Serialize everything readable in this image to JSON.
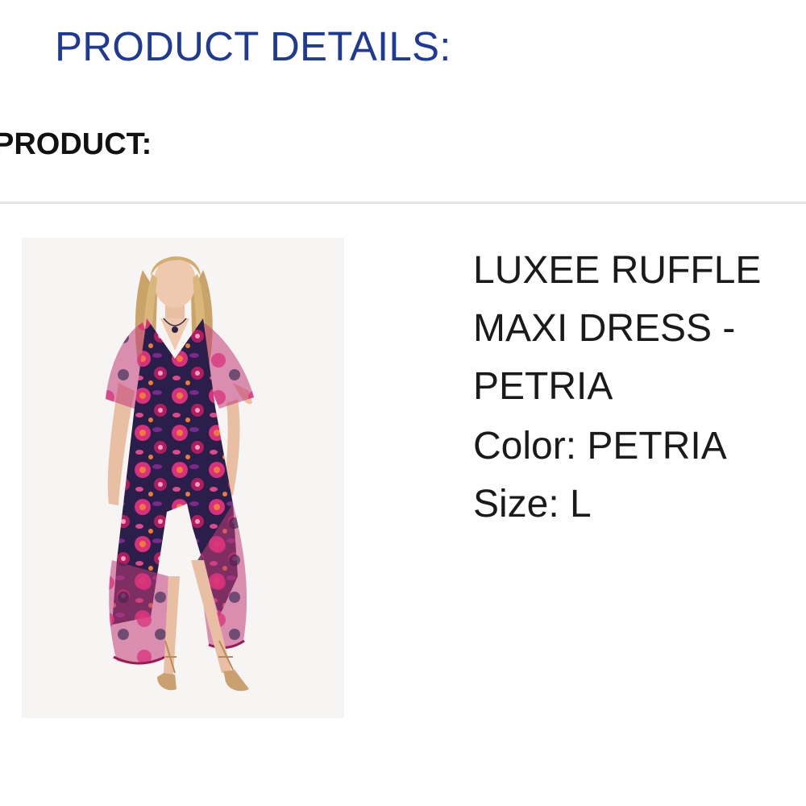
{
  "header": {
    "title": "PRODUCT DETAILS:",
    "section_label": "PRODUCT:"
  },
  "product": {
    "name": "LUXEE RUFFLE\nMAXI DRESS -\nPETRIA",
    "color_line": "Color: PETRIA",
    "size_line": "Size: L",
    "image_subject": "model-wearing-floral-ruffle-maxi-dress"
  },
  "colors": {
    "heading": "#1f3a93",
    "text": "#1a1a1a",
    "divider": "#e4e4e4",
    "dress_base": "#2a1f4a",
    "dress_pink": "#d8307a",
    "dress_magenta": "#b01d5e"
  }
}
